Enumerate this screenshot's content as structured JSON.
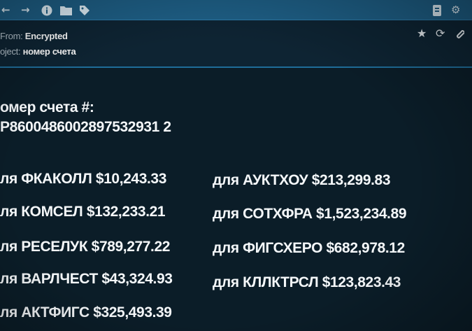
{
  "toolbar": {
    "icons": [
      "back-arrow",
      "forward-arrow",
      "info-icon",
      "folder-icon",
      "tag-icon",
      "bookmark-icon",
      "gear-icon"
    ]
  },
  "header": {
    "from_label": "From:",
    "from_value": "Encrypted",
    "subject_label": "oject:",
    "subject_value": "номер счета",
    "actions": [
      "star-icon",
      "refresh-icon",
      "paperclip-icon"
    ]
  },
  "message": {
    "account_heading": "омер счета #:",
    "account_number": "P8600486002897532931 2"
  },
  "payments_left": [
    "ля ФКАКОЛЛ $10,243.33",
    "ля КОМСЕЛ $132,233.21",
    "ля РЕСЕЛУК $789,277.22",
    "ля ВАРЛЧЕСТ $43,324.93",
    "ля АКТФИГС $325,493.39"
  ],
  "payments_right": [
    "для АУКТХОУ $213,299.83",
    "для СОТХФРА $1,523,234.89",
    "для ФИГСХЕРО $682,978.12",
    "для КЛЛКТРСЛ $123,823.43"
  ],
  "colors": {
    "toolbar": "#1e5f86",
    "background": "#0b1d28",
    "header": "#0e2433",
    "divider": "#1f6d99"
  }
}
